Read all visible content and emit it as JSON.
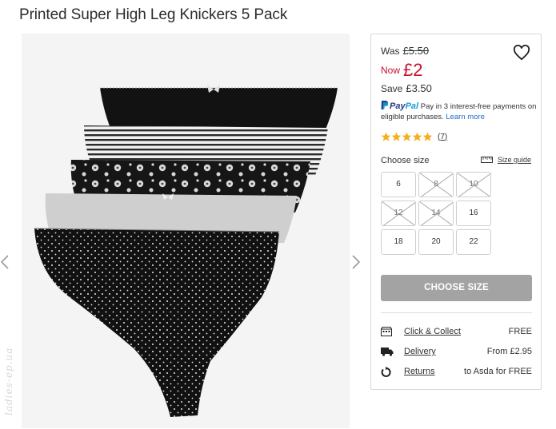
{
  "product": {
    "title": "Printed Super High Leg Knickers 5 Pack"
  },
  "pricing": {
    "was_label": "Was",
    "was_price": "£5.50",
    "now_label": "Now",
    "now_price": "£2",
    "save_label": "Save",
    "save_amount": "£3.50"
  },
  "paypal": {
    "brand_pay": "Pay",
    "brand_pal": "Pal",
    "text": "Pay in 3 interest-free payments on eligible purchases.",
    "learn_more": "Learn more"
  },
  "reviews": {
    "rating": 5,
    "count": "7"
  },
  "sizes": {
    "label": "Choose size",
    "guide_label": "Size guide",
    "options": [
      {
        "label": "6",
        "available": true
      },
      {
        "label": "8",
        "available": false
      },
      {
        "label": "10",
        "available": false
      },
      {
        "label": "12",
        "available": false
      },
      {
        "label": "14",
        "available": false
      },
      {
        "label": "16",
        "available": true
      },
      {
        "label": "18",
        "available": true
      },
      {
        "label": "20",
        "available": true
      },
      {
        "label": "22",
        "available": true
      }
    ]
  },
  "cta": {
    "choose_size": "CHOOSE SIZE"
  },
  "fulfilment": [
    {
      "icon": "store-icon",
      "label": "Click & Collect",
      "value": "FREE"
    },
    {
      "icon": "delivery-truck-icon",
      "label": "Delivery",
      "value": "From £2.95"
    },
    {
      "icon": "returns-icon",
      "label": "Returns",
      "value": "to Asda for FREE"
    }
  ],
  "watermark": "ladies-ep.ua",
  "colors": {
    "now_price": "#c8102e",
    "star": "#f2b01e",
    "button_disabled": "#a3a3a3",
    "link": "#1a6fc4"
  }
}
